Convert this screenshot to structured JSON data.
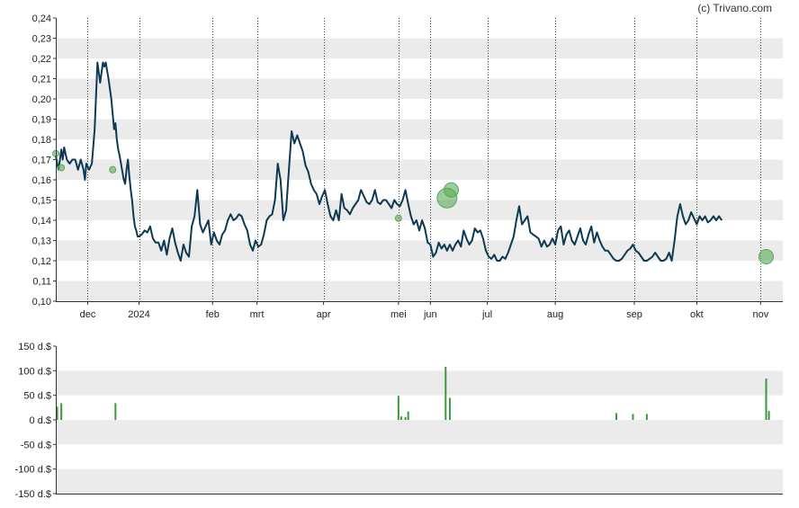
{
  "credit": "(c) Trivano.com",
  "colors": {
    "price_line": "#0d3a52",
    "band": "#ebebeb",
    "volume_bar": "#3a9a3a",
    "marker": "#5aaa5a",
    "axis": "#333333",
    "month_grid": "#444444"
  },
  "chart_data": [
    {
      "type": "line",
      "name": "price",
      "ylim": [
        0.1,
        0.24
      ],
      "y_ticks": [
        "0,24",
        "0,23",
        "0,22",
        "0,21",
        "0,20",
        "0,19",
        "0,18",
        "0,17",
        "0,16",
        "0,15",
        "0,14",
        "0,13",
        "0,12",
        "0,11",
        "0,10"
      ],
      "y_tick_values": [
        0.24,
        0.23,
        0.22,
        0.21,
        0.2,
        0.19,
        0.18,
        0.17,
        0.16,
        0.15,
        0.14,
        0.13,
        0.12,
        0.11,
        0.1
      ],
      "x_ticks": [
        "dec",
        "2024",
        "feb",
        "mrt",
        "apr",
        "mei",
        "jun",
        "jul",
        "aug",
        "sep",
        "okt",
        "nov"
      ],
      "x_tick_days": [
        23,
        60,
        113,
        145,
        193,
        247,
        270,
        311,
        360,
        417,
        462,
        508
      ],
      "grid": "alternating horizontal bands, dotted vertical month lines",
      "x": [
        0,
        1,
        2,
        3,
        4,
        5,
        6,
        8,
        10,
        12,
        14,
        16,
        18,
        20,
        21,
        22,
        24,
        26,
        28,
        30,
        32,
        34,
        35,
        36,
        38,
        40,
        42,
        43,
        44,
        45,
        46,
        47,
        48,
        49,
        50,
        51,
        52,
        53,
        54,
        55,
        56,
        57,
        58,
        59,
        60,
        62,
        64,
        66,
        68,
        70,
        72,
        74,
        76,
        78,
        80,
        82,
        84,
        86,
        88,
        90,
        92,
        94,
        96,
        98,
        100,
        102,
        104,
        106,
        108,
        110,
        112,
        114,
        116,
        118,
        120,
        122,
        124,
        126,
        128,
        130,
        132,
        134,
        136,
        138,
        140,
        142,
        144,
        146,
        148,
        150,
        152,
        154,
        156,
        158,
        160,
        162,
        164,
        166,
        168,
        170,
        172,
        174,
        176,
        178,
        180,
        182,
        184,
        186,
        188,
        190,
        192,
        194,
        196,
        198,
        200,
        202,
        204,
        206,
        208,
        210,
        212,
        214,
        216,
        218,
        220,
        222,
        224,
        226,
        228,
        230,
        232,
        234,
        236,
        238,
        240,
        242,
        244,
        246,
        248,
        250,
        252,
        254,
        256,
        258,
        260,
        262,
        264,
        266,
        268,
        270,
        272,
        274,
        276,
        278,
        280,
        282,
        284,
        286,
        288,
        290,
        292,
        294,
        296,
        298,
        300,
        302,
        304,
        306,
        308,
        310,
        312,
        314,
        316,
        318,
        320,
        322,
        324,
        326,
        328,
        330,
        332,
        334,
        336,
        338,
        340,
        342,
        344,
        346,
        348,
        350,
        352,
        354,
        356,
        358,
        360,
        362,
        364,
        366,
        368,
        370,
        372,
        374,
        376,
        378,
        380,
        382,
        384,
        386,
        388,
        390,
        392,
        394,
        396,
        398,
        400,
        402,
        404,
        406,
        408,
        410,
        412,
        414,
        416,
        418,
        420,
        422,
        424,
        426,
        428,
        430,
        432,
        434,
        436,
        438,
        440,
        442,
        444,
        446,
        448,
        450,
        452,
        454,
        456,
        458,
        460,
        462,
        464,
        466,
        468,
        470,
        472,
        474,
        476,
        478,
        480,
        482,
        484,
        486,
        488,
        490,
        492,
        494,
        496,
        498,
        500,
        502,
        504,
        506,
        508,
        510,
        512,
        514,
        516,
        518,
        520,
        522,
        523,
        524
      ],
      "y": [
        0.172,
        0.168,
        0.165,
        0.17,
        0.175,
        0.17,
        0.176,
        0.17,
        0.168,
        0.17,
        0.17,
        0.165,
        0.17,
        0.165,
        0.16,
        0.168,
        0.165,
        0.168,
        0.185,
        0.218,
        0.208,
        0.218,
        0.216,
        0.218,
        0.21,
        0.2,
        0.185,
        0.188,
        0.18,
        0.175,
        0.172,
        0.168,
        0.164,
        0.16,
        0.158,
        0.165,
        0.17,
        0.162,
        0.155,
        0.15,
        0.142,
        0.137,
        0.135,
        0.132,
        0.132,
        0.133,
        0.135,
        0.134,
        0.137,
        0.131,
        0.129,
        0.129,
        0.125,
        0.13,
        0.123,
        0.131,
        0.136,
        0.129,
        0.124,
        0.12,
        0.128,
        0.124,
        0.122,
        0.137,
        0.142,
        0.155,
        0.138,
        0.134,
        0.137,
        0.14,
        0.128,
        0.134,
        0.13,
        0.128,
        0.133,
        0.135,
        0.14,
        0.143,
        0.14,
        0.141,
        0.143,
        0.142,
        0.138,
        0.135,
        0.128,
        0.125,
        0.13,
        0.127,
        0.128,
        0.133,
        0.14,
        0.142,
        0.143,
        0.15,
        0.168,
        0.16,
        0.14,
        0.145,
        0.165,
        0.184,
        0.178,
        0.182,
        0.178,
        0.174,
        0.167,
        0.164,
        0.158,
        0.155,
        0.153,
        0.148,
        0.152,
        0.155,
        0.148,
        0.142,
        0.14,
        0.145,
        0.14,
        0.153,
        0.146,
        0.145,
        0.143,
        0.146,
        0.148,
        0.15,
        0.155,
        0.152,
        0.149,
        0.148,
        0.15,
        0.155,
        0.149,
        0.148,
        0.15,
        0.15,
        0.148,
        0.146,
        0.15,
        0.148,
        0.147,
        0.15,
        0.155,
        0.148,
        0.142,
        0.138,
        0.14,
        0.135,
        0.14,
        0.136,
        0.129,
        0.128,
        0.122,
        0.124,
        0.129,
        0.126,
        0.128,
        0.125,
        0.128,
        0.125,
        0.128,
        0.13,
        0.127,
        0.135,
        0.131,
        0.128,
        0.13,
        0.136,
        0.134,
        0.135,
        0.131,
        0.125,
        0.122,
        0.121,
        0.123,
        0.12,
        0.12,
        0.122,
        0.121,
        0.124,
        0.128,
        0.132,
        0.14,
        0.147,
        0.138,
        0.14,
        0.142,
        0.134,
        0.133,
        0.132,
        0.131,
        0.127,
        0.13,
        0.127,
        0.128,
        0.131,
        0.128,
        0.135,
        0.137,
        0.128,
        0.133,
        0.135,
        0.13,
        0.128,
        0.132,
        0.136,
        0.13,
        0.128,
        0.133,
        0.137,
        0.129,
        0.134,
        0.13,
        0.127,
        0.125,
        0.125,
        0.123,
        0.121,
        0.12,
        0.12,
        0.121,
        0.123,
        0.125,
        0.126,
        0.128,
        0.125,
        0.124,
        0.122,
        0.12,
        0.12,
        0.121,
        0.122,
        0.124,
        0.122,
        0.12,
        0.12,
        0.121,
        0.124,
        0.12,
        0.13,
        0.142,
        0.148,
        0.142,
        0.138,
        0.14,
        0.144,
        0.141,
        0.138,
        0.142,
        0.14,
        0.142,
        0.139,
        0.14,
        0.142,
        0.14,
        0.142,
        0.14
      ],
      "markers": [
        {
          "day": 0,
          "value": 0.173,
          "size": "small"
        },
        {
          "day": 4,
          "value": 0.166,
          "size": "small"
        },
        {
          "day": 41,
          "value": 0.165,
          "size": "small"
        },
        {
          "day": 247,
          "value": 0.141,
          "size": "small"
        },
        {
          "day": 282,
          "value": 0.151,
          "size": "large"
        },
        {
          "day": 285,
          "value": 0.155,
          "size": "medium"
        },
        {
          "day": 512,
          "value": 0.122,
          "size": "medium"
        }
      ]
    },
    {
      "type": "bar",
      "name": "volume",
      "ylim": [
        -150,
        150
      ],
      "y_ticks": [
        "150 d.$",
        "100 d.$",
        "50 d.$",
        "0 d.$",
        "-50 d.$",
        "-100 d.$",
        "-150 d.$"
      ],
      "y_tick_values": [
        150,
        100,
        50,
        0,
        -50,
        -100,
        -150
      ],
      "x": [
        1,
        4,
        43,
        247,
        249,
        252,
        254,
        281,
        284,
        404,
        416,
        426,
        512,
        514
      ],
      "values": [
        27,
        34,
        34,
        49,
        7,
        6,
        17,
        108,
        45,
        14,
        12,
        12,
        84,
        18
      ]
    }
  ]
}
